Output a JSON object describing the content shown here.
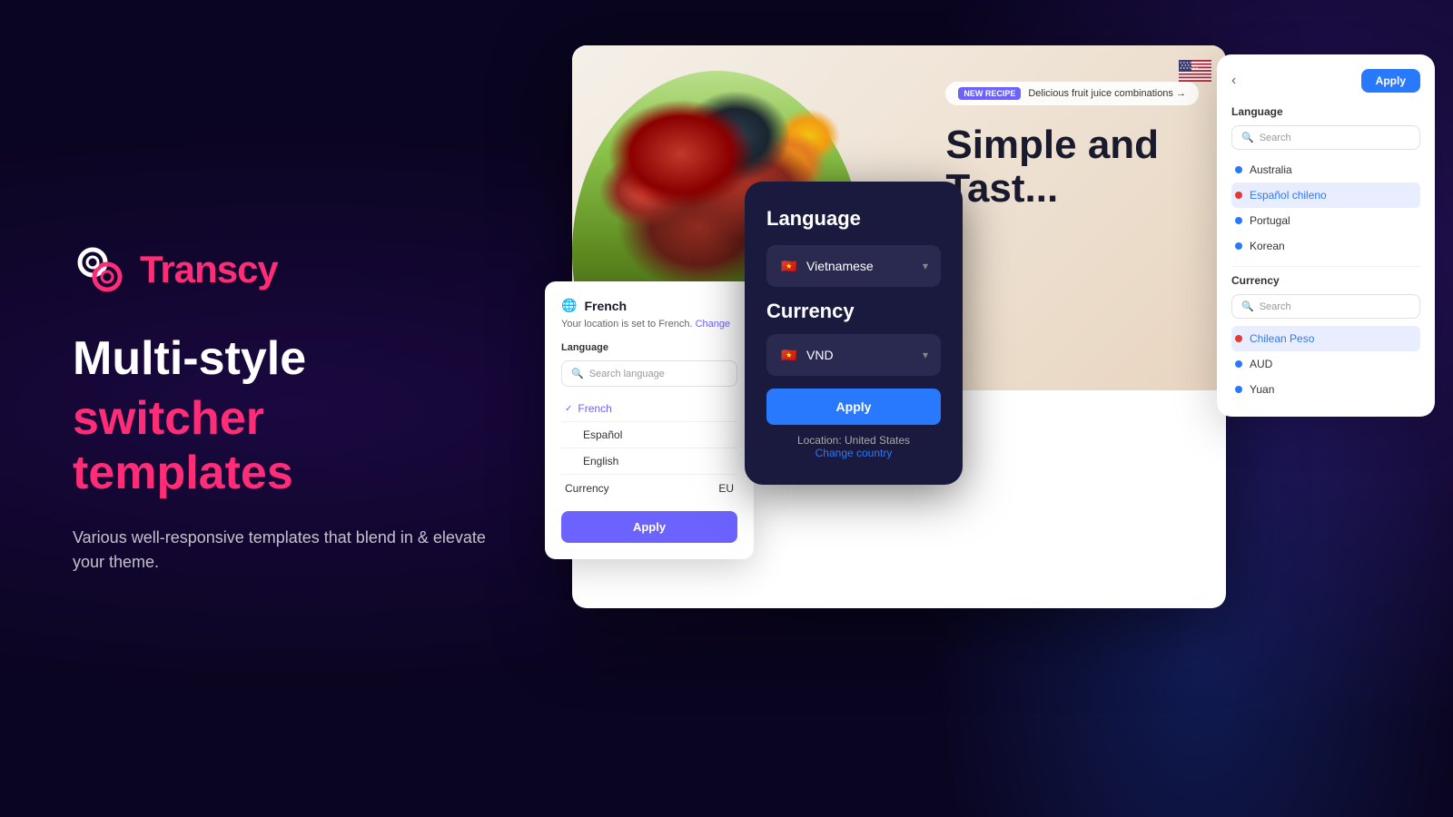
{
  "brand": {
    "name_prefix": "Trans",
    "name_suffix": "cy",
    "tagline_line1": "Multi-style",
    "tagline_line2": "switcher templates",
    "subtext": "Various well-responsive templates that blend in & elevate your theme."
  },
  "hero": {
    "badge_tag": "NEW RECIPE",
    "badge_text": "Delicious fruit juice combinations →",
    "title_line1": "Simple and",
    "title_line2": "Tast..."
  },
  "modal_french": {
    "title": "French",
    "globe_icon": "🌐",
    "location_text": "Your location is set to French.",
    "change_link": "Change",
    "language_label": "Language",
    "search_placeholder": "Search language",
    "lang_options": [
      {
        "label": "French",
        "selected": true
      },
      {
        "label": "Español",
        "selected": false
      },
      {
        "label": "English",
        "selected": false
      }
    ],
    "currency_label": "Currency",
    "currency_value": "EU",
    "apply_label": "Apply"
  },
  "modal_vnd": {
    "language_label": "Language",
    "language_value": "Vietnamese",
    "currency_label": "Currency",
    "currency_value": "VND",
    "apply_label": "Apply",
    "location_text": "Location: United States",
    "change_country": "Change country"
  },
  "modal_list": {
    "back_icon": "‹",
    "apply_label": "Apply",
    "language_label": "Language",
    "search_placeholder": "Search",
    "language_items": [
      {
        "label": "Australia",
        "highlighted": false
      },
      {
        "label": "Español chileno",
        "highlighted": true
      },
      {
        "label": "Portugal",
        "highlighted": false
      },
      {
        "label": "Korean",
        "highlighted": false
      }
    ],
    "currency_label": "Currency",
    "currency_search_placeholder": "Search",
    "currency_items": [
      {
        "label": "Chilean Peso",
        "highlighted": true
      },
      {
        "label": "AUD",
        "highlighted": false
      },
      {
        "label": "Yuan",
        "highlighted": false
      }
    ]
  }
}
